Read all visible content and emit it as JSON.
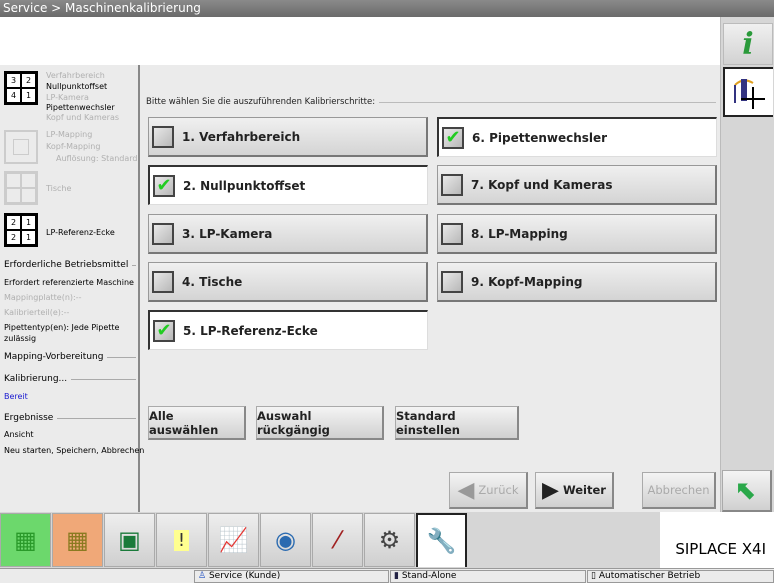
{
  "title": "Service > Maschinenkalibrierung",
  "left_panel": {
    "grid1": [
      "3",
      "2",
      "4",
      "1"
    ],
    "grid1_labels": [
      {
        "t": "Verfahrbereich",
        "dim": true
      },
      {
        "t": "Nullpunktoffset",
        "dim": false
      },
      {
        "t": "LP-Kamera",
        "dim": true
      },
      {
        "t": "Pipettenwechsler",
        "dim": false
      },
      {
        "t": "Kopf und Kameras",
        "dim": true
      }
    ],
    "grid2_labels": [
      "LP-Mapping",
      "Kopf-Mapping",
      "Auflösung: Standard"
    ],
    "grid3_label": "Tische",
    "grid4": [
      "2",
      "1",
      "2",
      "1"
    ],
    "grid4_label": "LP-Referenz-Ecke",
    "resources_heading": "Erforderliche Betriebsmittel",
    "res1": "Erfordert referenzierte Maschine",
    "res2": "Mappingplatte(n):--",
    "res3": "Kalibrierteil(e):--",
    "res4a": "Pipettentyp(en): Jede Pipette",
    "res4b": "zulässig",
    "mapping_heading": "Mapping-Vorbereitung",
    "calib_heading": "Kalibrierung...",
    "status": "Bereit",
    "results_heading": "Ergebnisse",
    "results1": "Ansicht",
    "results2": "Neu starten, Speichern, Abbrechen"
  },
  "prompt": "Bitte wählen Sie die auszuführenden Kalibrierschritte:",
  "steps": [
    {
      "label": "1. Verfahrbereich",
      "checked": false
    },
    {
      "label": "2. Nullpunktoffset",
      "checked": true
    },
    {
      "label": "3. LP-Kamera",
      "checked": false
    },
    {
      "label": "4. Tische",
      "checked": false
    },
    {
      "label": "5. LP-Referenz-Ecke",
      "checked": true
    },
    {
      "label": "6. Pipettenwechsler",
      "checked": true
    },
    {
      "label": "7. Kopf und Kameras",
      "checked": false
    },
    {
      "label": "8. LP-Mapping",
      "checked": false
    },
    {
      "label": "9. Kopf-Mapping",
      "checked": false
    }
  ],
  "buttons": {
    "select_all": "Alle auswählen",
    "undo": "Auswahl rückgängig",
    "default": "Standard einstellen",
    "back": "Zurück",
    "next": "Weiter",
    "cancel": "Abbrechen"
  },
  "brand": "SIPLACE X4I",
  "status_bar": {
    "user": "Service (Kunde)",
    "mode": "Stand-Alone",
    "operation": "Automatischer Betrieb"
  },
  "check_glyph": "✔"
}
